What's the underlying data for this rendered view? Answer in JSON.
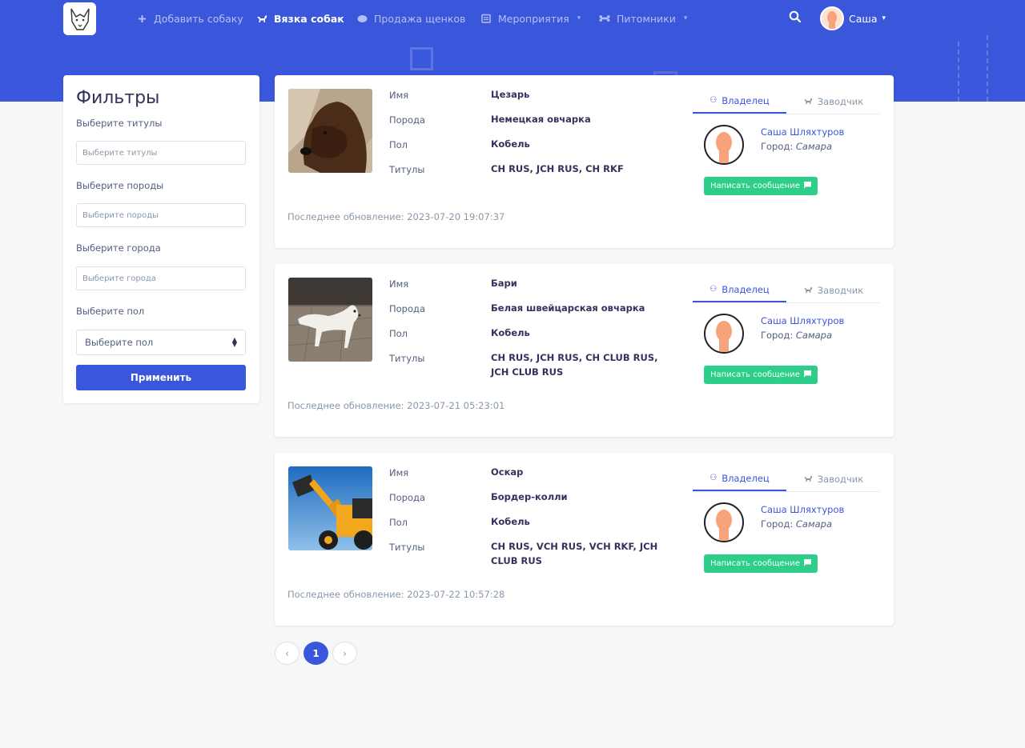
{
  "nav": {
    "items": [
      {
        "label": "Добавить собаку",
        "icon": "plus-icon"
      },
      {
        "label": "Вязка собак",
        "icon": "dog-icon"
      },
      {
        "label": "Продажа щенков",
        "icon": "bone-icon"
      },
      {
        "label": "Мероприятия",
        "icon": "calendar-icon"
      },
      {
        "label": "Питомники",
        "icon": "kennel-icon"
      }
    ],
    "user_name": "Саша"
  },
  "filters": {
    "title": "Фильтры",
    "titles_label": "Выберите титулы",
    "titles_placeholder": "Выберите титулы",
    "breeds_label": "Выберите породы",
    "breeds_placeholder": "Выберите породы",
    "cities_label": "Выберите города",
    "cities_placeholder": "Выберите города",
    "sex_label": "Выберите пол",
    "sex_value": "Выберите пол",
    "apply_label": "Применить"
  },
  "labels": {
    "name": "Имя",
    "breed": "Порода",
    "sex": "Пол",
    "titles": "Титулы"
  },
  "dogs": [
    {
      "name": "Цезарь",
      "breed": "Немецкая овчарка",
      "sex": "Кобель",
      "titles": "CH RUS, JCH RUS, CH RKF",
      "updated": "Последнее обновление: 2023-07-20 19:07:37",
      "tab_owner": "Владелец",
      "tab_breeder": "Заводчик",
      "owner_name": "Саша Шляхтуров",
      "city_label": "Город:",
      "city": "Самара",
      "message_label": "Написать сообщение"
    },
    {
      "name": "Бари",
      "breed": "Белая швейцарская овчарка",
      "sex": "Кобель",
      "titles": "CH RUS, JCH RUS, CH CLUB RUS, JCH CLUB RUS",
      "updated": "Последнее обновление: 2023-07-21 05:23:01",
      "tab_owner": "Владелец",
      "tab_breeder": "Заводчик",
      "owner_name": "Саша Шляхтуров",
      "city_label": "Город:",
      "city": "Самара",
      "message_label": "Написать сообщение"
    },
    {
      "name": "Оскар",
      "breed": "Бордер-колли",
      "sex": "Кобель",
      "titles": "CH RUS, VCH RUS, VCH RKF, JCH CLUB RUS",
      "updated": "Последнее обновление: 2023-07-22 10:57:28",
      "tab_owner": "Владелец",
      "tab_breeder": "Заводчик",
      "owner_name": "Саша Шляхтуров",
      "city_label": "Город:",
      "city": "Самара",
      "message_label": "Написать сообщение"
    }
  ],
  "pagination": {
    "prev": "‹",
    "current": "1",
    "next": "›"
  },
  "colors": {
    "primary": "#3a56db",
    "success": "#2dce89",
    "background": "#f5f7f9"
  }
}
